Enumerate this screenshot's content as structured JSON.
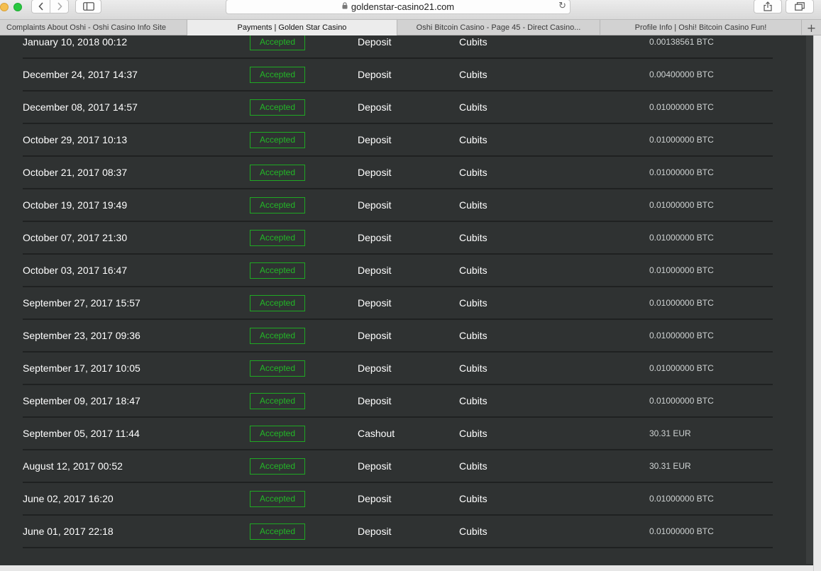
{
  "browser": {
    "url": "goldenstar-casino21.com",
    "tabs": [
      {
        "label": "Complaints About Oshi - Oshi Casino Info Site",
        "active": false
      },
      {
        "label": "Payments | Golden Star Casino",
        "active": true
      },
      {
        "label": "Oshi Bitcoin Casino - Page 45 - Direct Casino...",
        "active": false
      },
      {
        "label": "Profile Info | Oshi! Bitcoin Casino Fun!",
        "active": false
      }
    ],
    "new_tab_label": "+"
  },
  "payments": [
    {
      "date": "January 10, 2018 00:12",
      "status": "Accepted",
      "type": "Deposit",
      "method": "Cubits",
      "amount": "0.00138561 BTC"
    },
    {
      "date": "December 24, 2017 14:37",
      "status": "Accepted",
      "type": "Deposit",
      "method": "Cubits",
      "amount": "0.00400000 BTC"
    },
    {
      "date": "December 08, 2017 14:57",
      "status": "Accepted",
      "type": "Deposit",
      "method": "Cubits",
      "amount": "0.01000000 BTC"
    },
    {
      "date": "October 29, 2017 10:13",
      "status": "Accepted",
      "type": "Deposit",
      "method": "Cubits",
      "amount": "0.01000000 BTC"
    },
    {
      "date": "October 21, 2017 08:37",
      "status": "Accepted",
      "type": "Deposit",
      "method": "Cubits",
      "amount": "0.01000000 BTC"
    },
    {
      "date": "October 19, 2017 19:49",
      "status": "Accepted",
      "type": "Deposit",
      "method": "Cubits",
      "amount": "0.01000000 BTC"
    },
    {
      "date": "October 07, 2017 21:30",
      "status": "Accepted",
      "type": "Deposit",
      "method": "Cubits",
      "amount": "0.01000000 BTC"
    },
    {
      "date": "October 03, 2017 16:47",
      "status": "Accepted",
      "type": "Deposit",
      "method": "Cubits",
      "amount": "0.01000000 BTC"
    },
    {
      "date": "September 27, 2017 15:57",
      "status": "Accepted",
      "type": "Deposit",
      "method": "Cubits",
      "amount": "0.01000000 BTC"
    },
    {
      "date": "September 23, 2017 09:36",
      "status": "Accepted",
      "type": "Deposit",
      "method": "Cubits",
      "amount": "0.01000000 BTC"
    },
    {
      "date": "September 17, 2017 10:05",
      "status": "Accepted",
      "type": "Deposit",
      "method": "Cubits",
      "amount": "0.01000000 BTC"
    },
    {
      "date": "September 09, 2017 18:47",
      "status": "Accepted",
      "type": "Deposit",
      "method": "Cubits",
      "amount": "0.01000000 BTC"
    },
    {
      "date": "September 05, 2017 11:44",
      "status": "Accepted",
      "type": "Cashout",
      "method": "Cubits",
      "amount": "30.31 EUR"
    },
    {
      "date": "August 12, 2017 00:52",
      "status": "Accepted",
      "type": "Deposit",
      "method": "Cubits",
      "amount": "30.31 EUR"
    },
    {
      "date": "June 02, 2017 16:20",
      "status": "Accepted",
      "type": "Deposit",
      "method": "Cubits",
      "amount": "0.01000000 BTC"
    },
    {
      "date": "June 01, 2017 22:18",
      "status": "Accepted",
      "type": "Deposit",
      "method": "Cubits",
      "amount": "0.01000000 BTC"
    }
  ],
  "colors": {
    "page_background": "#2f3232",
    "row_divider": "#1f2121",
    "accepted_green": "#23b727"
  },
  "icons": {
    "back": "chevron-left-icon",
    "forward": "chevron-right-icon",
    "sidebar": "sidebar-icon",
    "lock": "lock-icon",
    "reload": "reload-icon",
    "share": "share-icon",
    "tabs": "tab-overview-icon"
  }
}
